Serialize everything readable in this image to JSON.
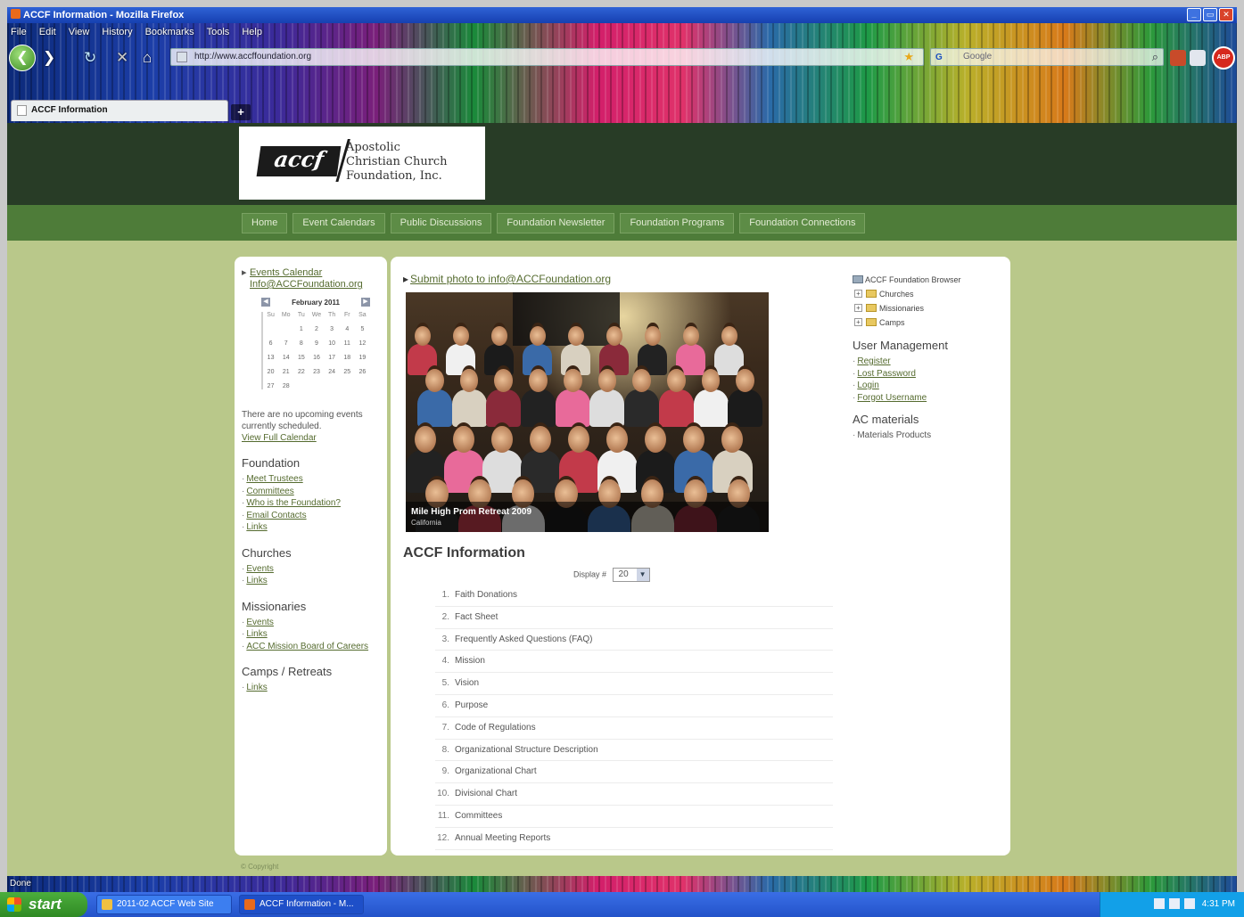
{
  "window": {
    "title": "ACCF Information - Mozilla Firefox",
    "controls": [
      "_",
      "▭",
      "✕"
    ]
  },
  "menubar": [
    "File",
    "Edit",
    "View",
    "History",
    "Bookmarks",
    "Tools",
    "Help"
  ],
  "navbar": {
    "url": "http://www.accffoundation.org",
    "search_placeholder": "Google"
  },
  "tab": {
    "title": "ACCF Information",
    "new_tab_label": "+"
  },
  "site": {
    "logo": {
      "mark": "accf",
      "name_lines": [
        "Apostolic",
        "Christian Church",
        "Foundation, Inc."
      ]
    },
    "nav": [
      "Home",
      "Event Calendars",
      "Public Discussions",
      "Foundation Newsletter",
      "Foundation Programs",
      "Foundation Connections"
    ],
    "left": {
      "calendar_link_line1": "Events Calendar",
      "calendar_link_line2": "Info@ACCFoundation.org",
      "calendar_month": "February 2011",
      "calendar_prev": "◀",
      "calendar_next": "▶",
      "weekdays": [
        "Su",
        "Mo",
        "Tu",
        "We",
        "Th",
        "Fr",
        "Sa"
      ],
      "calendar_days": [
        "",
        "",
        "1",
        "2",
        "3",
        "4",
        "5",
        "6",
        "7",
        "8",
        "9",
        "10",
        "11",
        "12",
        "13",
        "14",
        "15",
        "16",
        "17",
        "18",
        "19",
        "20",
        "21",
        "22",
        "23",
        "24",
        "25",
        "26",
        "27",
        "28",
        "",
        "",
        "",
        "",
        ""
      ],
      "calendar_note": "There are no upcoming events currently scheduled.",
      "view_full_calendar": "View Full Calendar",
      "sections": [
        {
          "heading": "Foundation",
          "items": [
            "Meet Trustees",
            "Committees",
            "Who is the Foundation?",
            "Email Contacts",
            "Links"
          ]
        },
        {
          "heading": "Churches",
          "items": [
            "Events",
            "Links"
          ]
        },
        {
          "heading": "Missionaries",
          "items": [
            "Events",
            "Links",
            "ACC Mission Board of Careers"
          ]
        },
        {
          "heading": "Camps / Retreats",
          "items": [
            "Links"
          ]
        }
      ]
    },
    "main": {
      "submit_photo": "Submit photo to info@ACCFoundation.org",
      "photo_caption_title": "Mile High Prom Retreat 2009",
      "photo_caption_sub": "California",
      "info_title": "ACCF Information",
      "display_label": "Display #",
      "display_value": "20",
      "items": [
        "Faith Donations",
        "Fact Sheet",
        "Frequently Asked Questions (FAQ)",
        "Mission",
        "Vision",
        "Purpose",
        "Code of Regulations",
        "Organizational Structure Description",
        "Organizational Chart",
        "Divisional Chart",
        "Committees",
        "Annual Meeting Reports"
      ]
    },
    "right": {
      "tree_root": "ACCF Foundation Browser",
      "tree_items": [
        "Churches",
        "Missionaries",
        "Camps"
      ],
      "user_heading": "User Management",
      "user_links": [
        "Register",
        "Lost Password",
        "Login",
        "Forgot Username"
      ],
      "materials_heading": "AC materials",
      "materials_links": [
        "Materials Products"
      ]
    },
    "footer_note": "© Copyright"
  },
  "status": "Done",
  "taskbar": {
    "start_label": "start",
    "tasks": [
      "2011-02 ACCF Web Site",
      "ACCF Information - M..."
    ],
    "clock": "4:31 PM"
  }
}
